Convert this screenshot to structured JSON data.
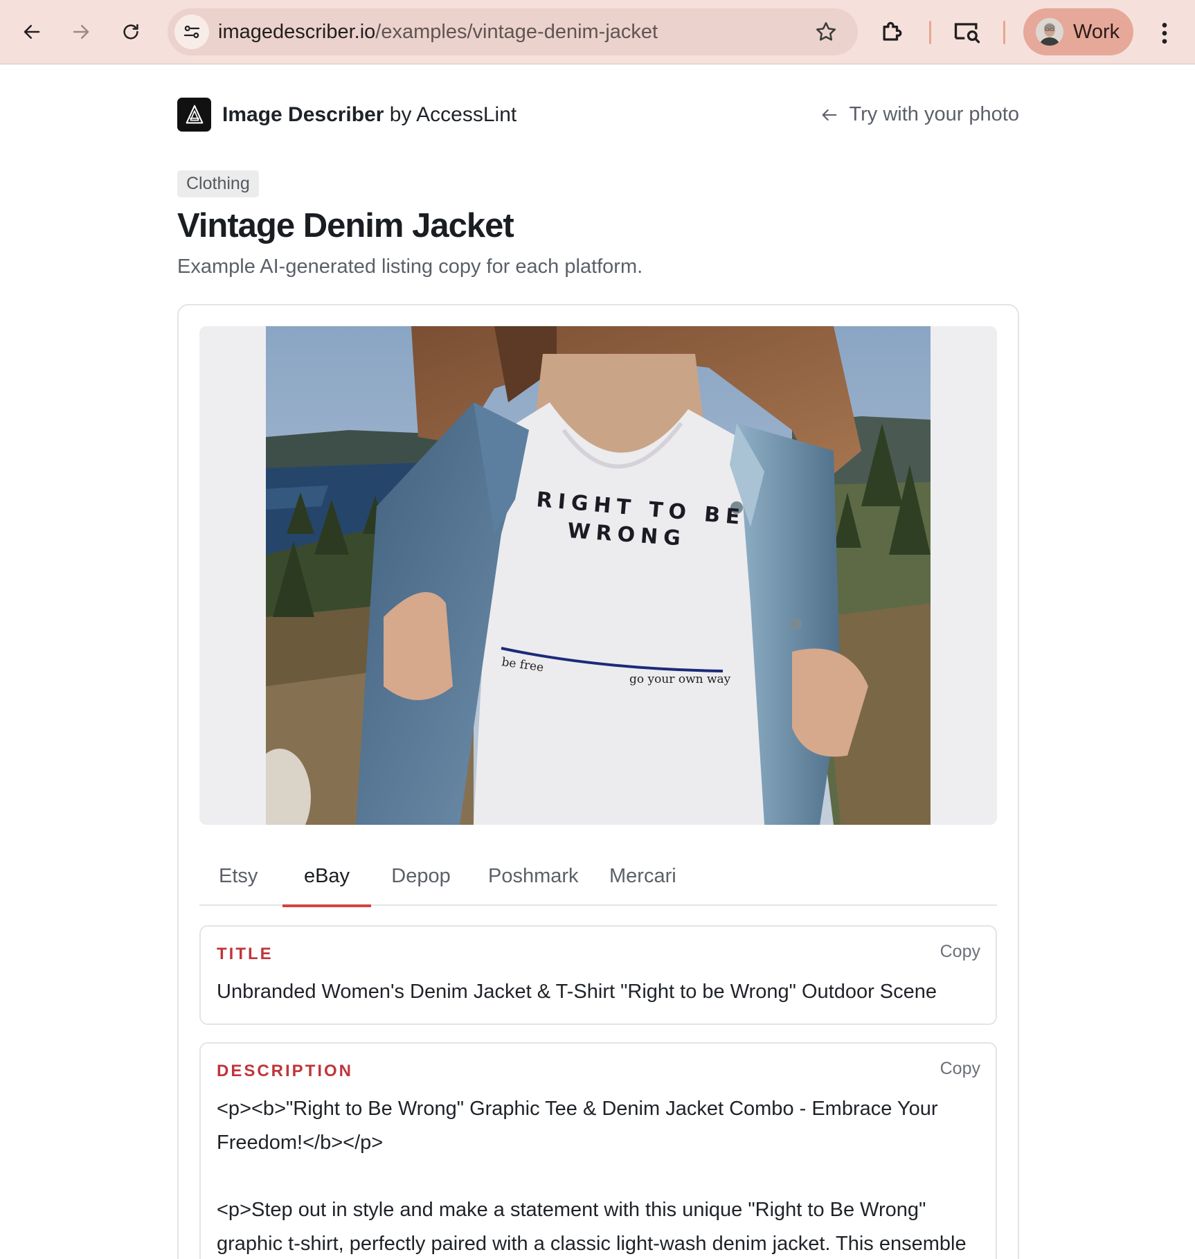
{
  "browser": {
    "url_domain": "imagedescriber.io",
    "url_path": "/examples/vintage-denim-jacket",
    "profile_name": "Work",
    "icons": [
      "back-arrow-icon",
      "forward-arrow-icon",
      "reload-icon",
      "site-info-icon",
      "star-icon",
      "extensions-icon",
      "cast-icon",
      "more-vert-icon"
    ]
  },
  "header": {
    "brand_name": "Image Describer",
    "brand_suffix": " by AccessLint",
    "try_link": "Try with your photo"
  },
  "main": {
    "badge": "Clothing",
    "title": "Vintage Denim Jacket",
    "subtitle": "Example AI-generated listing copy for each platform."
  },
  "image": {
    "shirt_line1": "RIGHT TO BE",
    "shirt_line2": "WRONG",
    "shirt_left": "be free",
    "shirt_right": "go your own way"
  },
  "tabs": [
    {
      "label": "Etsy",
      "active": false
    },
    {
      "label": "eBay",
      "active": true
    },
    {
      "label": "Depop",
      "active": false
    },
    {
      "label": "Poshmark",
      "active": false
    },
    {
      "label": "Mercari",
      "active": false
    }
  ],
  "listing": {
    "title_label": "TITLE",
    "title_copy": "Copy",
    "title_text": "Unbranded Women's Denim Jacket & T-Shirt \"Right to be Wrong\" Outdoor Scene",
    "description_label": "DESCRIPTION",
    "description_copy": "Copy",
    "description_p1": "<p><b>\"Right to Be Wrong\" Graphic Tee & Denim Jacket Combo - Embrace Your Freedom!</b></p>",
    "description_p2": "<p>Step out in style and make a statement with this unique \"Right to Be Wrong\" graphic t-shirt, perfectly paired with a classic light-wash denim jacket. This ensemble"
  },
  "colors": {
    "chrome_bg": "#f6e0db",
    "accent": "#d1433f",
    "label_red": "#c0353a"
  }
}
